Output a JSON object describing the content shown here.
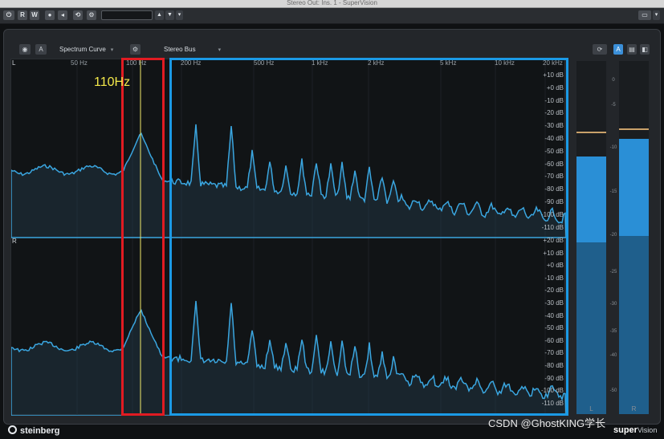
{
  "window": {
    "title": "Stereo Out: Ins. 1 - SuperVision"
  },
  "toolbar": {
    "power_icon": "power-icon",
    "read_label": "R",
    "write_label": "W"
  },
  "panel": {
    "mode_label": "A",
    "view_select": "Spectrum Curve",
    "bus_select": "Stereo Bus",
    "mode_a_label": "A"
  },
  "spectrum": {
    "channel_left": "L",
    "channel_right": "R",
    "freq_labels": [
      "50 Hz",
      "100 Hz",
      "200 Hz",
      "500 Hz",
      "1 kHz",
      "2 kHz",
      "5 kHz",
      "10 kHz",
      "20 kHz"
    ],
    "db_labels_left": [
      "+10 dB",
      "+0 dB",
      "-10 dB",
      "-20 dB",
      "-30 dB",
      "-40 dB",
      "-50 dB",
      "-60 dB",
      "-70 dB",
      "-80 dB",
      "-90 dB",
      "-100 dB",
      "-110 dB"
    ],
    "db_labels_right": [
      "+20 dB",
      "+10 dB",
      "+0 dB",
      "-10 dB",
      "-20 dB",
      "-30 dB",
      "-40 dB",
      "-50 dB",
      "-60 dB",
      "-70 dB",
      "-80 dB",
      "-90 dB",
      "-100 dB",
      "-110 dB"
    ],
    "annotation": "110Hz"
  },
  "meters": {
    "left_label": "L",
    "right_label": "R",
    "scale": [
      "0",
      "-5",
      "-10",
      "-15",
      "-20",
      "-25",
      "-30",
      "-35",
      "-40",
      "-50"
    ],
    "left_level": 0.27,
    "right_level": 0.22,
    "colors": {
      "fill": "#2a8fd6",
      "fill_dim": "#1f5f8c",
      "peak": "#c9a16a"
    }
  },
  "colors": {
    "curve": "#3aa6e0",
    "red_box": "#e11b22",
    "blue_box": "#1b9ae6",
    "annotation": "#f4e94a"
  },
  "footer": {
    "brand": "steinberg",
    "product": "super",
    "product_suffix": "Vision",
    "watermark": "CSDN @GhostKING学长"
  }
}
